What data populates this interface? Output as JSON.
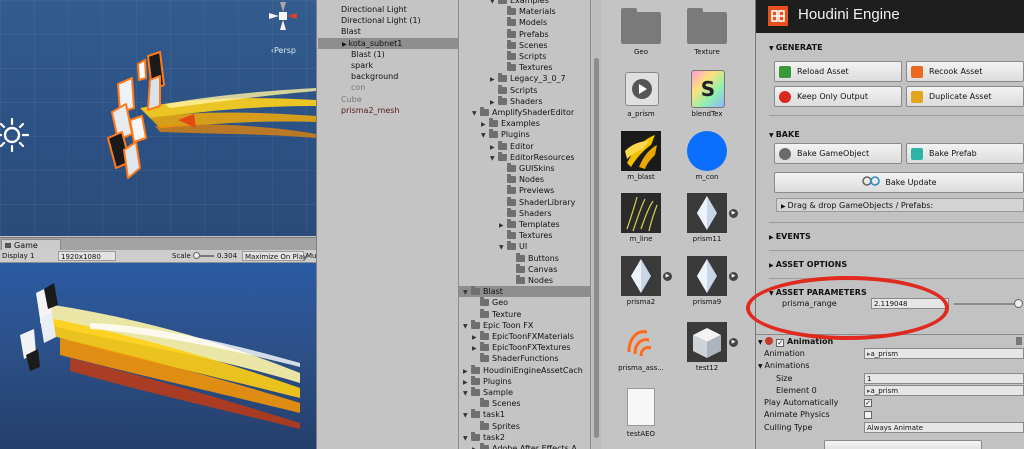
{
  "scene": {
    "persp_label": "‹Persp"
  },
  "game": {
    "tab_label": "Game",
    "display": "Display 1",
    "resolution": "1920x1080",
    "scale_label": "Scale",
    "scale_value": "0.304",
    "maximize_label": "Maximize On Play",
    "mute_label": "Mut"
  },
  "hierarchy": {
    "items": [
      {
        "label": "Directional Light",
        "indent": 0,
        "selected": false,
        "color": "#111111"
      },
      {
        "label": "Directional Light (1)",
        "indent": 0,
        "selected": false,
        "color": "#111111"
      },
      {
        "label": "Blast",
        "indent": 0,
        "selected": false,
        "color": "#111111"
      },
      {
        "label": "kota_subnet1",
        "indent": 1,
        "selected": true,
        "color": "#111111"
      },
      {
        "label": "Blast (1)",
        "indent": 1,
        "selected": false,
        "color": "#111111"
      },
      {
        "label": "spark",
        "indent": 1,
        "selected": false,
        "color": "#111111"
      },
      {
        "label": "background",
        "indent": 1,
        "selected": false,
        "color": "#111111"
      },
      {
        "label": "con",
        "indent": 1,
        "selected": false,
        "color": "#777777"
      },
      {
        "label": "Cube",
        "indent": 0,
        "selected": false,
        "color": "#777777"
      },
      {
        "label": "prisma2_mesh",
        "indent": 0,
        "selected": false,
        "color": "#5a1a1a"
      }
    ]
  },
  "project_tree": {
    "items": [
      {
        "label": "Examples",
        "indent": 3,
        "arrow": "▼",
        "selected": false
      },
      {
        "label": "Materials",
        "indent": 4,
        "arrow": "",
        "selected": false
      },
      {
        "label": "Models",
        "indent": 4,
        "arrow": "",
        "selected": false
      },
      {
        "label": "Prefabs",
        "indent": 4,
        "arrow": "",
        "selected": false
      },
      {
        "label": "Scenes",
        "indent": 4,
        "arrow": "",
        "selected": false
      },
      {
        "label": "Scripts",
        "indent": 4,
        "arrow": "",
        "selected": false
      },
      {
        "label": "Textures",
        "indent": 4,
        "arrow": "",
        "selected": false
      },
      {
        "label": "Legacy_3_0_7",
        "indent": 3,
        "arrow": "▶",
        "selected": false
      },
      {
        "label": "Scripts",
        "indent": 3,
        "arrow": "",
        "selected": false
      },
      {
        "label": "Shaders",
        "indent": 3,
        "arrow": "▶",
        "selected": false
      },
      {
        "label": "AmplifyShaderEditor",
        "indent": 1,
        "arrow": "▼",
        "selected": false
      },
      {
        "label": "Examples",
        "indent": 2,
        "arrow": "▶",
        "selected": false
      },
      {
        "label": "Plugins",
        "indent": 2,
        "arrow": "▼",
        "selected": false
      },
      {
        "label": "Editor",
        "indent": 3,
        "arrow": "▶",
        "selected": false
      },
      {
        "label": "EditorResources",
        "indent": 3,
        "arrow": "▼",
        "selected": false
      },
      {
        "label": "GUISkins",
        "indent": 4,
        "arrow": "",
        "selected": false
      },
      {
        "label": "Nodes",
        "indent": 4,
        "arrow": "",
        "selected": false
      },
      {
        "label": "Previews",
        "indent": 4,
        "arrow": "",
        "selected": false
      },
      {
        "label": "ShaderLibrary",
        "indent": 4,
        "arrow": "",
        "selected": false
      },
      {
        "label": "Shaders",
        "indent": 4,
        "arrow": "",
        "selected": false
      },
      {
        "label": "Templates",
        "indent": 4,
        "arrow": "▶",
        "selected": false
      },
      {
        "label": "Textures",
        "indent": 4,
        "arrow": "",
        "selected": false
      },
      {
        "label": "UI",
        "indent": 4,
        "arrow": "▼",
        "selected": false
      },
      {
        "label": "Buttons",
        "indent": 5,
        "arrow": "",
        "selected": false
      },
      {
        "label": "Canvas",
        "indent": 5,
        "arrow": "",
        "selected": false
      },
      {
        "label": "Nodes",
        "indent": 5,
        "arrow": "",
        "selected": false
      },
      {
        "label": "Blast",
        "indent": 0,
        "arrow": "▼",
        "selected": true
      },
      {
        "label": "Geo",
        "indent": 1,
        "arrow": "",
        "selected": false
      },
      {
        "label": "Texture",
        "indent": 1,
        "arrow": "",
        "selected": false
      },
      {
        "label": "Epic Toon FX",
        "indent": 0,
        "arrow": "▼",
        "selected": false
      },
      {
        "label": "EpicToonFXMaterials",
        "indent": 1,
        "arrow": "▶",
        "selected": false
      },
      {
        "label": "EpicToonFXTextures",
        "indent": 1,
        "arrow": "▶",
        "selected": false
      },
      {
        "label": "ShaderFunctions",
        "indent": 1,
        "arrow": "",
        "selected": false
      },
      {
        "label": "HoudiniEngineAssetCach",
        "indent": 0,
        "arrow": "▶",
        "selected": false
      },
      {
        "label": "Plugins",
        "indent": 0,
        "arrow": "▶",
        "selected": false
      },
      {
        "label": "Sample",
        "indent": 0,
        "arrow": "▼",
        "selected": false
      },
      {
        "label": "Scenes",
        "indent": 1,
        "arrow": "",
        "selected": false
      },
      {
        "label": "task1",
        "indent": 0,
        "arrow": "▼",
        "selected": false
      },
      {
        "label": "Sprites",
        "indent": 1,
        "arrow": "",
        "selected": false
      },
      {
        "label": "task2",
        "indent": 0,
        "arrow": "▼",
        "selected": false
      },
      {
        "label": "Adobe After Effects A",
        "indent": 1,
        "arrow": "▶",
        "selected": false
      }
    ]
  },
  "assets": {
    "items": [
      {
        "label": "Geo",
        "kind": "folder"
      },
      {
        "label": "Texture",
        "kind": "folder"
      },
      {
        "label": "a_prism",
        "kind": "anim"
      },
      {
        "label": "blendTex",
        "kind": "shader"
      },
      {
        "label": "m_blast",
        "kind": "blast"
      },
      {
        "label": "m_con",
        "kind": "sphere"
      },
      {
        "label": "m_line",
        "kind": "line"
      },
      {
        "label": "prism11",
        "kind": "crystal"
      },
      {
        "label": "prisma2",
        "kind": "crystal"
      },
      {
        "label": "prisma9",
        "kind": "crystal"
      },
      {
        "label": "prisma_ass...",
        "kind": "houdini"
      },
      {
        "label": "test12",
        "kind": "cube"
      },
      {
        "label": "testAEO",
        "kind": "doc"
      }
    ]
  },
  "inspector": {
    "title": "Houdini Engine",
    "generate_label": "GENERATE",
    "reload_label": "Reload Asset",
    "recook_label": "Recook Asset",
    "keep_output_label": "Keep Only Output",
    "duplicate_label": "Duplicate Asset",
    "bake_label": "BAKE",
    "bake_gameobject_label": "Bake GameObject",
    "bake_prefab_label": "Bake Prefab",
    "bake_update_label": "Bake Update",
    "drag_drop_label": "Drag & drop GameObjects / Prefabs:",
    "events_label": "EVENTS",
    "asset_options_label": "ASSET OPTIONS",
    "asset_params_label": "ASSET PARAMETERS",
    "param_name": "prisma_range",
    "param_value": "2.119048",
    "param_slider": 0.99,
    "animation_label": "Animation",
    "anim_field_label": "Animation",
    "anim_field_value": "a_prism",
    "animations_label": "Animations",
    "size_label": "Size",
    "size_value": "1",
    "element0_label": "Element 0",
    "element0_value": "a_prism",
    "play_auto_label": "Play Automatically",
    "play_auto_checked": true,
    "anim_physics_label": "Animate Physics",
    "anim_physics_checked": false,
    "culling_label": "Culling Type",
    "culling_value": "Always Animate"
  },
  "colors": {
    "highlight_ring": "#df2a1d",
    "houdini_orange": "#e8501e",
    "selection": "#8e8e8e"
  }
}
